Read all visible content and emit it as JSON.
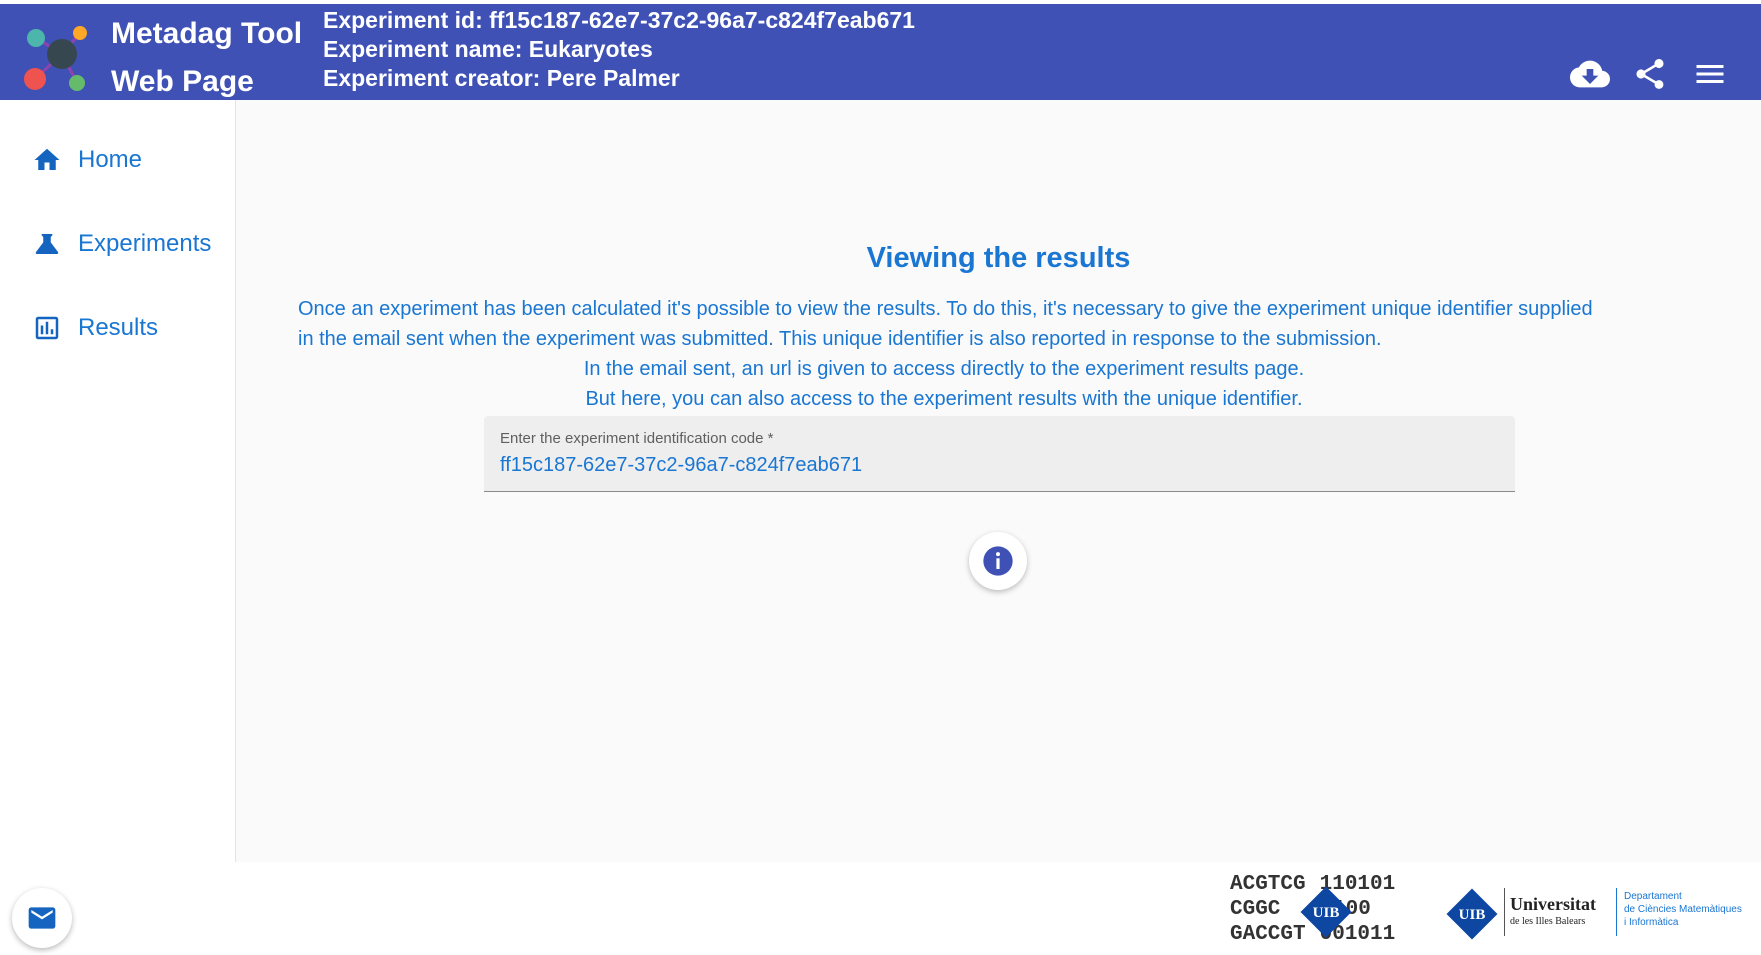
{
  "header": {
    "app_title_line1": "Metadag Tool",
    "app_title_line2": "Web Page",
    "experiment_id": "Experiment id: ff15c187-62e7-37c2-96a7-c824f7eab671",
    "experiment_name": "Experiment name: Eukaryotes",
    "experiment_creator": "Experiment creator: Pere Palmer",
    "actions": [
      {
        "icon": "cloud-download-icon"
      },
      {
        "icon": "share-icon"
      },
      {
        "icon": "menu-icon"
      }
    ]
  },
  "sidebar": {
    "items": [
      {
        "label": "Home",
        "icon": "home-icon"
      },
      {
        "label": "Experiments",
        "icon": "flask-icon"
      },
      {
        "label": "Results",
        "icon": "bar-chart-icon"
      }
    ]
  },
  "main": {
    "title": "Viewing the results",
    "paragraph_lines": [
      "Once an experiment has been calculated it's possible to view the results. To do this, it's necessary to give the experiment unique identifier supplied",
      "in the email sent when the experiment was submitted. This unique identifier is also reported in response to the submission.",
      "In the email sent, an url is given to access directly to the experiment results page.",
      "But here, you can also access to the experiment results with the unique identifier."
    ],
    "input": {
      "label": "Enter the experiment identification code *",
      "value": "ff15c187-62e7-37c2-96a7-c824f7eab671"
    },
    "info_button_icon": "info-icon"
  },
  "footer": {
    "mail_button_icon": "mail-icon",
    "dna_logo_lines": [
      "ACGTCG",
      "CGGC",
      "GACCGT"
    ],
    "dna_logo_digits": [
      "110101",
      "1100",
      "001011"
    ],
    "dna_logo_badge": "UIB",
    "uib_badge": "UIB",
    "uib_name": "Universitat",
    "uib_subname": "de les Illes Balears",
    "dept_line1": "Departament",
    "dept_line2": "de Ciències Matemàtiques",
    "dept_line3": "i Informàtica"
  },
  "colors": {
    "header_bg": "#3f51b5",
    "accent": "#1976d2",
    "main_bg": "#fafafa",
    "logo_teal": "#4db6ac",
    "logo_orange": "#ffa726",
    "logo_red": "#ef5350",
    "logo_green": "#66bb6a",
    "logo_center": "#37474f"
  }
}
